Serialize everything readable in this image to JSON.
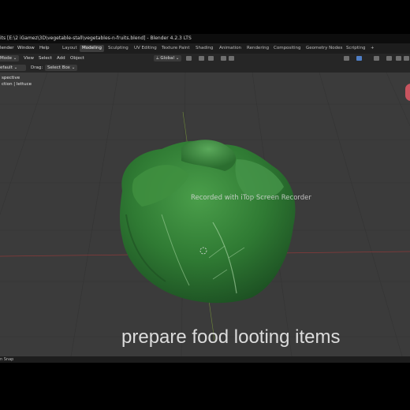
{
  "titlebar": {
    "title": "its [E:\\2 iGamez\\3D\\vegetable-stall\\vegetables-n-fruits.blend] - Blender 4.2.3 LTS"
  },
  "menu": {
    "items": [
      "lender",
      "Window",
      "Help"
    ]
  },
  "workspaces": [
    "Layout",
    "Modeling",
    "Sculpting",
    "UV Editing",
    "Texture Paint",
    "Shading",
    "Animation",
    "Rendering",
    "Compositing",
    "Geometry Nodes",
    "Scripting",
    "+"
  ],
  "active_workspace": "Modeling",
  "header": {
    "mode": "Mode",
    "view": "View",
    "select": "Select",
    "add": "Add",
    "object": "Object",
    "orientation": "Global"
  },
  "tool_settings": {
    "preset": "efault",
    "drag_label": "Drag:",
    "drag_value": "Select Box"
  },
  "viewport": {
    "view_name": "spective",
    "collection": "ction | lettuce",
    "watermark": "Recorded with iTop Screen Recorder",
    "subtitle": "prepare food looting items"
  },
  "status": {
    "text": "n Snap"
  },
  "colors": {
    "viewport_bg": "#3b3b3b",
    "grid": "#333333",
    "lettuce": "#3f8f3f"
  }
}
